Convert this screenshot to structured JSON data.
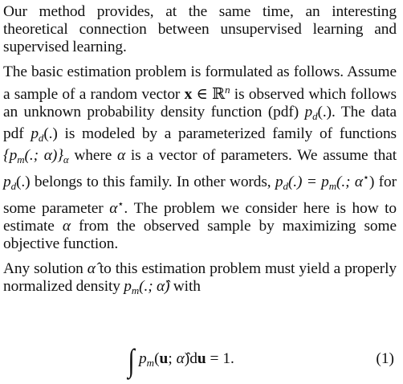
{
  "paragraphs": {
    "p1": "Our method provides, at the same time, an interesting theoretical connection between unsupervised learning and supervised learning.",
    "p2": {
      "s1": "The basic estimation problem is formulated as follows. Assume a sample of a random vector",
      "x_sym": "x",
      "in_R": " ∈ ℝ",
      "n_sup": "n",
      "s2": " is observed which follows an unknown probability density function (pdf)",
      "pd": "p",
      "d_sub": "d",
      "arg": "(.)",
      "s3": ". The data pdf",
      "s4": " is modeled by a parameterized family of functions",
      "family": "{p",
      "m_sub": "m",
      "family_args": "(.; α)}",
      "alpha_sub": "α",
      "s5": " where",
      "alpha": "α",
      "s6": " is a vector of parameters. We assume that",
      "s7": " belongs to this family. In other words,",
      "eq_part": "(.) = p",
      "eq_args": "(.; α",
      "star": "⋆",
      "close": ")",
      "s8": " for some parameter",
      "s9": ". The problem we consider here is how to estimate",
      "s10": " from the observed sample by maximizing some objective function."
    },
    "p3": {
      "s1": "Any solution",
      "alpha_hat": "α̂",
      "s2": " to this estimation problem must yield a properly normalized density",
      "pm": "p",
      "m_sub": "m",
      "args": "(.; α̂)",
      "s3": " with"
    }
  },
  "equation": {
    "integral": "∫",
    "p": "p",
    "m_sub": "m",
    "open": "(",
    "u": "u",
    "semi": ";",
    "alpha_hat": " α̂",
    "close": ")d",
    "u2": "u",
    "rhs": " = 1.",
    "number": "(1)"
  }
}
